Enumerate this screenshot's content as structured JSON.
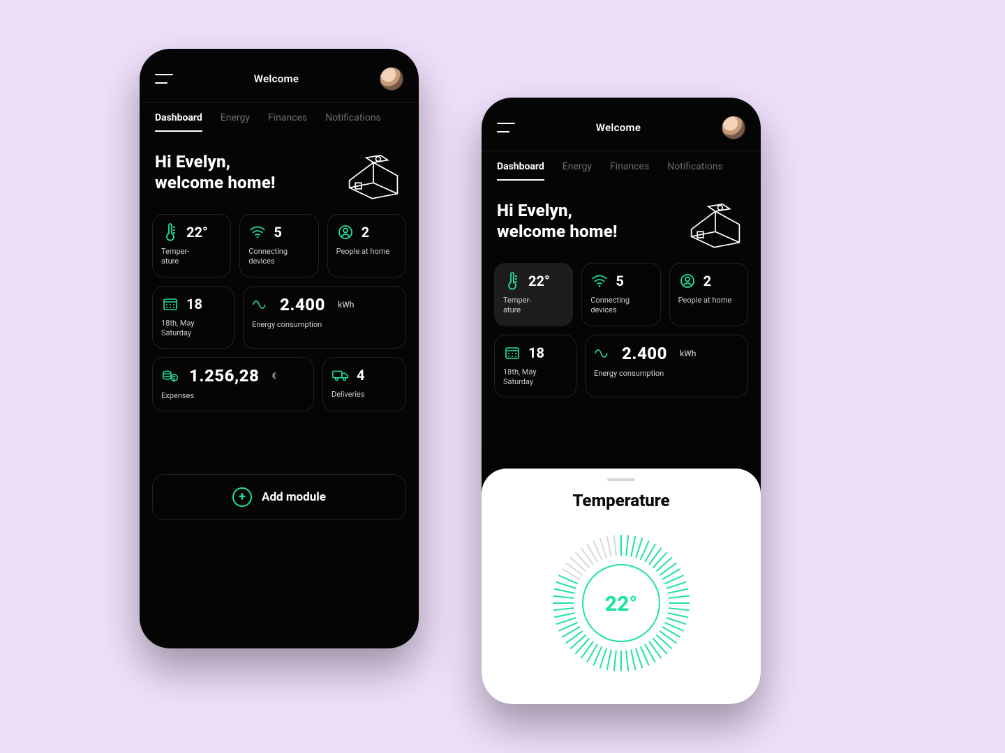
{
  "colors": {
    "accent": "#1fe2a5",
    "bg": "#efdffb",
    "phone": "#050505"
  },
  "header": {
    "title": "Welcome"
  },
  "tabs": [
    "Dashboard",
    "Energy",
    "Finances",
    "Notifications"
  ],
  "active_tab": "Dashboard",
  "greeting": {
    "line1": "Hi Evelyn,",
    "line2": "welcome home!"
  },
  "cards": {
    "temperature": {
      "value": "22°",
      "label": "Temper-\nature"
    },
    "devices": {
      "value": "5",
      "label": "Connecting devices"
    },
    "people": {
      "value": "2",
      "label": "People at home"
    },
    "date": {
      "value": "18",
      "label": "18th, May\nSaturday"
    },
    "energy": {
      "value": "2.400",
      "unit": "kWh",
      "label": "Energy consumption"
    },
    "expenses": {
      "value": "1.256,28",
      "unit": "€",
      "label": "Expenses"
    },
    "deliveries": {
      "value": "4",
      "label": "Deliveries"
    }
  },
  "add_module_label": "Add module",
  "sheet": {
    "title": "Temperature",
    "value": "22°"
  }
}
